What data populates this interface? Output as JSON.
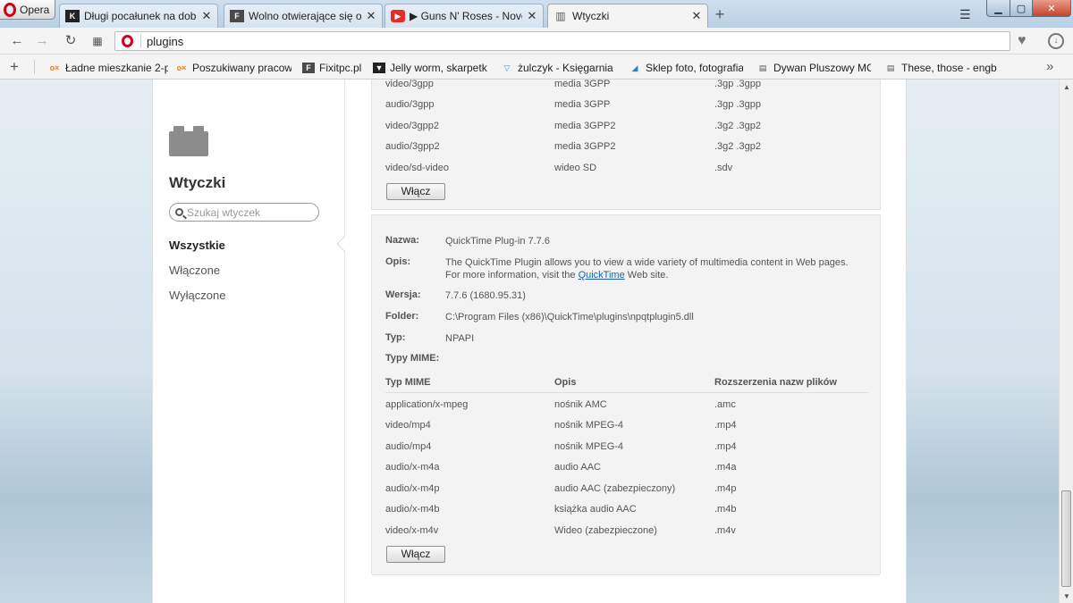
{
  "browser": {
    "menu_label": "Opera",
    "tabs": [
      {
        "title": "Długi pocałunek na dobrań",
        "favicon": "K",
        "favicon_color": "#222222"
      },
      {
        "title": "Wolno otwierające się okn",
        "favicon": "F",
        "favicon_color": "#4a4a4a"
      },
      {
        "title": "▶ Guns N' Roses - Novem",
        "favicon": "▶",
        "favicon_color": "#e52d27"
      },
      {
        "title": "Wtyczki",
        "favicon": "▥",
        "favicon_color": "#555555"
      }
    ],
    "address": "plugins",
    "bookmarks": [
      {
        "label": "Ładne mieszkanie 2-p",
        "icon": "o×",
        "icon_color": "#e8822a"
      },
      {
        "label": "Poszukiwany pracow",
        "icon": "o×",
        "icon_color": "#e8822a"
      },
      {
        "label": "Fixitpc.pl",
        "icon": "F",
        "icon_color": "#4a4a4a"
      },
      {
        "label": "Jelly worm, skarpetki",
        "icon": "▼",
        "icon_color": "#222222"
      },
      {
        "label": "żulczyk - Księgarnia I",
        "icon": "🛒",
        "icon_color": "#4a90d9"
      },
      {
        "label": "Sklep foto, fotografia",
        "icon": "◢",
        "icon_color": "#2a7fd4"
      },
      {
        "label": "Dywan Pluszowy MO",
        "icon": "▤",
        "icon_color": "#555555"
      },
      {
        "label": "These, those - engbo",
        "icon": "▤",
        "icon_color": "#555555"
      }
    ]
  },
  "sidebar": {
    "title": "Wtyczki",
    "search_placeholder": "Szukaj wtyczek",
    "nav": [
      "Wszystkie",
      "Włączone",
      "Wyłączone"
    ]
  },
  "plugin1": {
    "mime_rows": [
      {
        "type": "video/3gpp",
        "desc": "media 3GPP",
        "ext": ".3gp .3gpp"
      },
      {
        "type": "audio/3gpp",
        "desc": "media 3GPP",
        "ext": ".3gp .3gpp"
      },
      {
        "type": "video/3gpp2",
        "desc": "media 3GPP2",
        "ext": ".3g2 .3gp2"
      },
      {
        "type": "audio/3gpp2",
        "desc": "media 3GPP2",
        "ext": ".3g2 .3gp2"
      },
      {
        "type": "video/sd-video",
        "desc": "wideo SD",
        "ext": ".sdv"
      }
    ],
    "button": "Włącz"
  },
  "plugin2": {
    "labels": {
      "name": "Nazwa:",
      "desc": "Opis:",
      "version": "Wersja:",
      "folder": "Folder:",
      "type": "Typ:",
      "mime": "Typy MIME:"
    },
    "name": "QuickTime Plug-in 7.7.6",
    "desc_prefix": "The QuickTime Plugin allows you to view a wide variety of multimedia content in Web pages. For more information, visit the ",
    "desc_link": "QuickTime",
    "desc_suffix": " Web site.",
    "version": "7.7.6 (1680.95.31)",
    "folder": "C:\\Program Files (x86)\\QuickTime\\plugins\\npqtplugin5.dll",
    "type": "NPAPI",
    "mime_headers": {
      "type": "Typ MIME",
      "desc": "Opis",
      "ext": "Rozszerzenia nazw plików"
    },
    "mime_rows": [
      {
        "type": "application/x-mpeg",
        "desc": "nośnik AMC",
        "ext": ".amc"
      },
      {
        "type": "video/mp4",
        "desc": "nośnik MPEG-4",
        "ext": ".mp4"
      },
      {
        "type": "audio/mp4",
        "desc": "nośnik MPEG-4",
        "ext": ".mp4"
      },
      {
        "type": "audio/x-m4a",
        "desc": "audio AAC",
        "ext": ".m4a"
      },
      {
        "type": "audio/x-m4p",
        "desc": "audio AAC (zabezpieczony)",
        "ext": ".m4p"
      },
      {
        "type": "audio/x-m4b",
        "desc": "książka audio AAC",
        "ext": ".m4b"
      },
      {
        "type": "video/x-m4v",
        "desc": "Wideo (zabezpieczone)",
        "ext": ".m4v"
      }
    ],
    "button": "Włącz"
  }
}
